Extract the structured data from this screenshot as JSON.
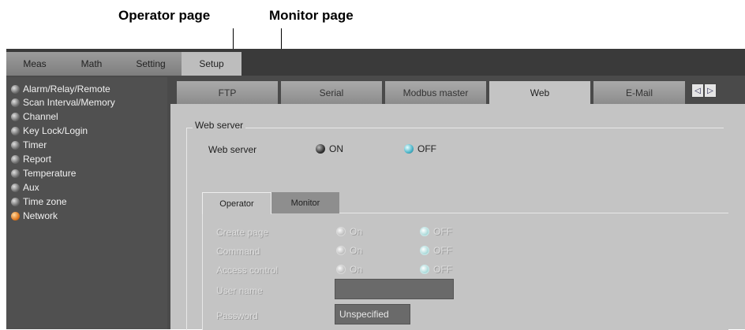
{
  "callouts": {
    "operator_page": "Operator page",
    "monitor_page": "Monitor page"
  },
  "top_tabs": [
    "Meas",
    "Math",
    "Setting",
    "Setup"
  ],
  "sidebar": {
    "items": [
      {
        "label": "Alarm/Relay/Remote"
      },
      {
        "label": "Scan Interval/Memory"
      },
      {
        "label": "Channel"
      },
      {
        "label": "Key Lock/Login"
      },
      {
        "label": "Timer"
      },
      {
        "label": "Report"
      },
      {
        "label": "Temperature"
      },
      {
        "label": "Aux"
      },
      {
        "label": "Time zone"
      },
      {
        "label": "Network"
      }
    ],
    "active_index": 9
  },
  "sub_tabs": [
    "FTP",
    "Serial",
    "Modbus master",
    "Web",
    "E-Mail"
  ],
  "nav_arrows": {
    "left": "◁",
    "right": "▷"
  },
  "web_server": {
    "group_title": "Web server",
    "label": "Web server",
    "on_label": "ON",
    "off_label": "OFF"
  },
  "inner_tabs": {
    "operator": "Operator",
    "monitor": "Monitor"
  },
  "operator_form": {
    "rows": [
      {
        "label": "Create page",
        "on": "On",
        "off": "OFF"
      },
      {
        "label": "Command",
        "on": "On",
        "off": "OFF"
      },
      {
        "label": "Access control",
        "on": "On",
        "off": "OFF"
      }
    ],
    "user_name_label": "User name",
    "user_name_value": "",
    "password_label": "Password",
    "password_value": "Unspecified"
  },
  "colors": {
    "accent_on": "#e07a20",
    "teal": "#4bb4c8",
    "panel": "#c4c4c4",
    "frame": "#4a4a4a"
  }
}
